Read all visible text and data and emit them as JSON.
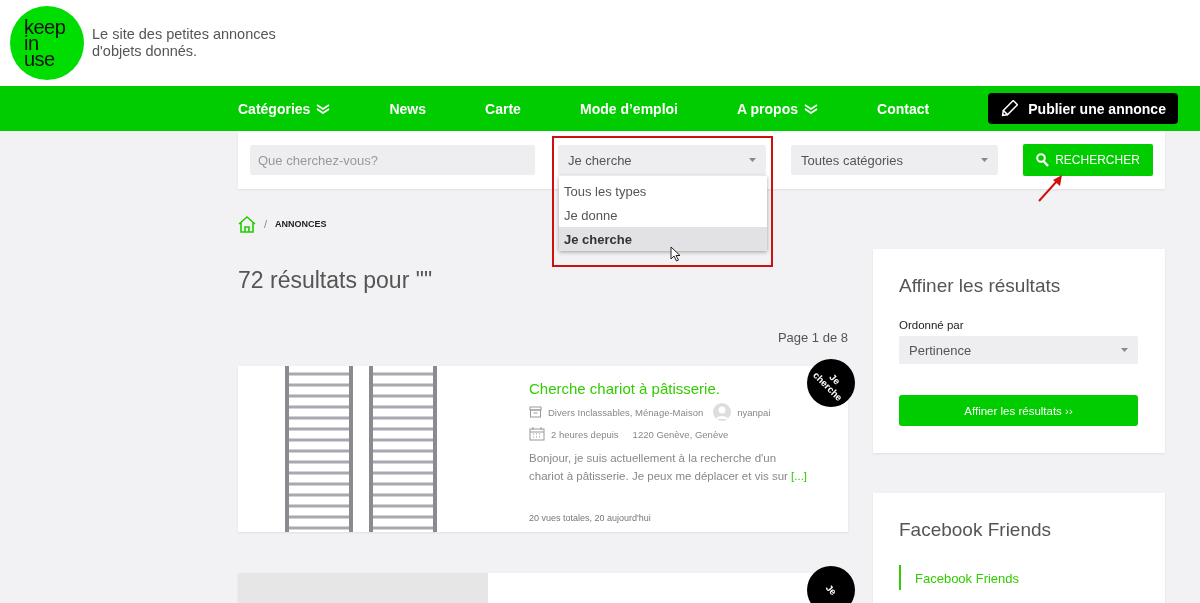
{
  "header": {
    "logo_text": "keep in use",
    "tagline": "Le site des petites annonces d'objets donnés."
  },
  "nav": {
    "items": [
      {
        "label": "Catégories",
        "has_menu": true
      },
      {
        "label": "News",
        "has_menu": false
      },
      {
        "label": "Carte",
        "has_menu": false
      },
      {
        "label": "Mode d’emploi",
        "has_menu": false
      },
      {
        "label": "A propos",
        "has_menu": true
      },
      {
        "label": "Contact",
        "has_menu": false
      }
    ],
    "publish_button": "Publier une annonce"
  },
  "search": {
    "placeholder": "Que cherchez-vous?",
    "type_select": {
      "value": "Je cherche",
      "expanded": true,
      "options": [
        {
          "label": "Tous les types",
          "selected": false
        },
        {
          "label": "Je donne",
          "selected": false
        },
        {
          "label": "Je cherche",
          "selected": true
        }
      ]
    },
    "category_select": {
      "value": "Toutes catégories"
    },
    "button": "RECHERCHER"
  },
  "breadcrumb": {
    "separator": "/",
    "current": "ANNONCES"
  },
  "results": {
    "heading": "72 résultats pour \"\"",
    "page": "Page 1 de 8",
    "listings": [
      {
        "badge": "Je cherche",
        "title": "Cherche chariot à pâtisserie.",
        "categories": "Divers Inclassables, Ménage-Maison",
        "user": "nyanpai",
        "time": "2 heures depuis",
        "location": "1220 Genève, Genève",
        "description": "Bonjour, je suis actuellement à la recherche d'un chariot à pâtisserie. Je peux me déplacer et vis sur",
        "more": "[...]",
        "views": "20 vues totales, 20 aujourd'hui"
      },
      {
        "badge": "Je"
      }
    ]
  },
  "sidebar": {
    "refine": {
      "title": "Affiner les résultats",
      "sort_label": "Ordonné par",
      "sort_value": "Pertinence",
      "button": "Affiner les résultats ››"
    },
    "facebook": {
      "title": "Facebook Friends",
      "link": "Facebook Friends"
    }
  }
}
